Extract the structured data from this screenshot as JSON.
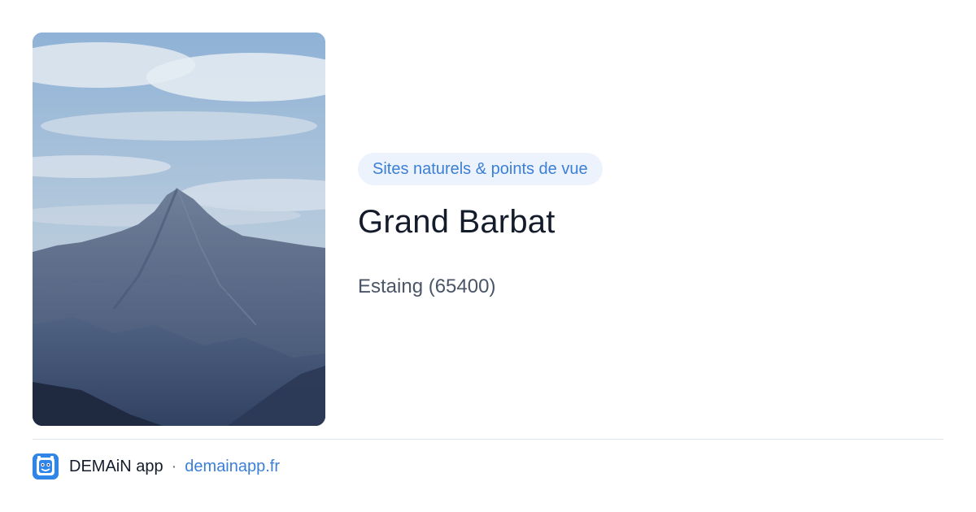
{
  "place": {
    "category": "Sites naturels & points de vue",
    "title": "Grand Barbat",
    "location": "Estaing (65400)"
  },
  "photo": {
    "subject": "mountain-peak-photo"
  },
  "footer": {
    "app_name": "DEMAiN app",
    "separator": "·",
    "link": "demainapp.fr",
    "logo_icon": "demain-app-logo-icon"
  },
  "colors": {
    "accent": "#3b7fd6",
    "badge_bg": "#edf3fc",
    "title": "#141b2b",
    "muted": "#4a5567",
    "logo_bg": "#2f86e8"
  }
}
